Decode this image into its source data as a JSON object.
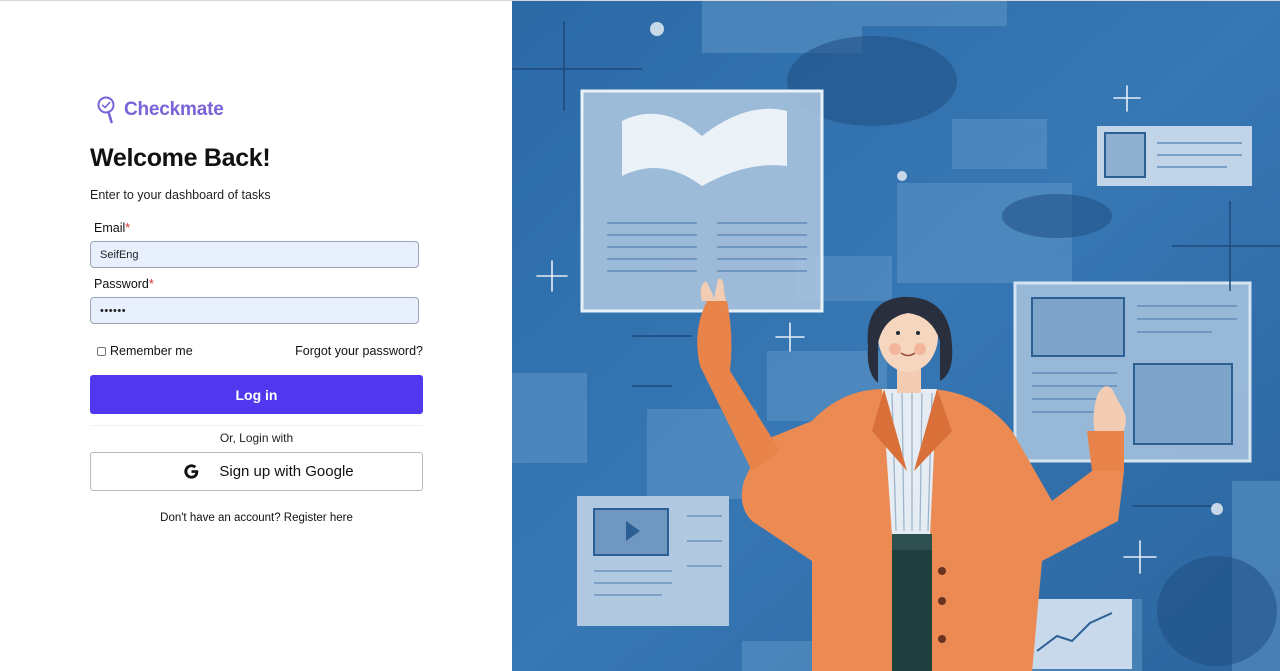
{
  "brand": {
    "name": "Checkmate",
    "logo_icon": "magnifier-check-icon",
    "color": "#7a63d8"
  },
  "login": {
    "title": "Welcome Back!",
    "subtitle": "Enter to your dashboard of tasks",
    "email": {
      "label": "Email",
      "required_mark": "*",
      "value": "SeifEng"
    },
    "password": {
      "label": "Password",
      "required_mark": "*",
      "value": "••••••"
    },
    "remember_label": "Remember me",
    "remember_checked": false,
    "forgot_label": "Forgot your password?",
    "login_label": "Log in",
    "divider_label": "Or, Login with",
    "google_label": "Sign up with Google",
    "register_text": "Don't have an account? Register here"
  },
  "colors": {
    "primary": "#5138ee",
    "input_bg": "#e8f0fe",
    "illustration_bg": "#2f6ea8",
    "jacket": "#e8834a"
  },
  "illustration": {
    "icon": "woman-with-floating-documents-illustration"
  }
}
